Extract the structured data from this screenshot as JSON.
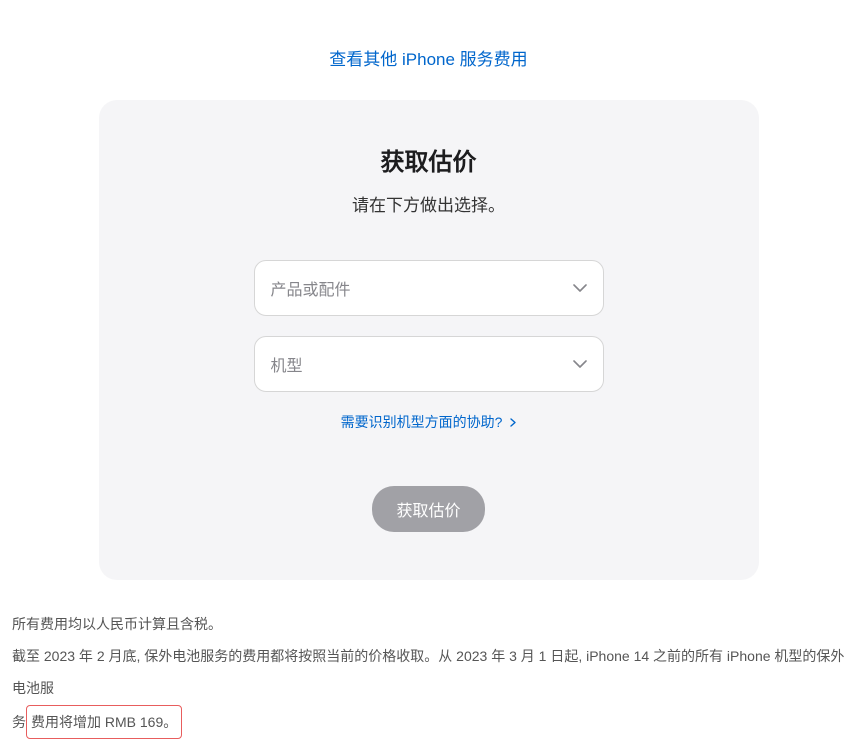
{
  "topLink": {
    "text": "查看其他 iPhone 服务费用"
  },
  "card": {
    "title": "获取估价",
    "subtitle": "请在下方做出选择。",
    "select1": {
      "placeholder": "产品或配件"
    },
    "select2": {
      "placeholder": "机型"
    },
    "helpLink": {
      "text": "需要识别机型方面的协助?"
    },
    "submitButton": {
      "label": "获取估价"
    }
  },
  "footer": {
    "line1": "所有费用均以人民币计算且含税。",
    "line2_part1": "截至 2023 年 2 月底, 保外电池服务的费用都将按照当前的价格收取。从 2023 年 3 月 1 日起, iPhone 14 之前的所有 iPhone 机型的保外电池服",
    "line2_part2_prefix": "务",
    "line2_highlight": "费用将增加 RMB 169。"
  }
}
